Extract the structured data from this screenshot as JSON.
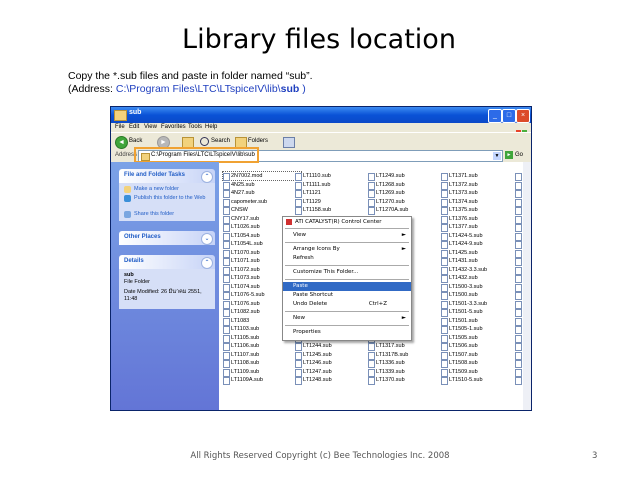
{
  "slide": {
    "title": "Library files location",
    "instruction_line1": "Copy the *.sub files and paste in folder named “sub”.",
    "instruction_address_prefix": "(Address: ",
    "instruction_address_path": "C:\\Program Files\\LTC\\LTspiceIV\\lib\\",
    "instruction_address_bold": "sub",
    "instruction_address_suffix": " )",
    "footer": "All Rights Reserved Copyright (c) Bee Technologies Inc. 2008",
    "page_number": "3"
  },
  "window": {
    "title": "sub",
    "menu": [
      "File",
      "Edit",
      "View",
      "Favorites",
      "Tools",
      "Help"
    ],
    "toolbar": {
      "back": "Back",
      "search": "Search",
      "folders": "Folders"
    },
    "address_label": "Address",
    "address_value": "C:\\Program Files\\LTC\\LTspiceIV\\lib\\sub",
    "go_label": "Go"
  },
  "taskpane": {
    "file_tasks_title": "File and Folder Tasks",
    "file_tasks": [
      "Make a new folder",
      "Publish this folder to the Web",
      "Share this folder"
    ],
    "other_places_title": "Other Places",
    "details_title": "Details",
    "details_name": "sub",
    "details_type": "File Folder",
    "details_modified": "Date Modified: 26 มีนาคม 2551,",
    "details_time": "11:48"
  },
  "files": {
    "col1": [
      "2N7002.mod",
      "4N25.sub",
      "4N27.sub",
      "capometer.sub",
      "CNSW",
      "CNY17.sub",
      "LT1026.sub",
      "LT1054.sub",
      "LT1054L.sub",
      "LT1070.sub",
      "LT1071.sub",
      "LT1072.sub",
      "LT1073.sub",
      "LT1074.sub",
      "LT1076-5.sub",
      "LT1076.sub",
      "LT1082.sub",
      "LT1083",
      "LT1103.sub",
      "LT1105.sub",
      "LT1106.sub",
      "LT1107.sub",
      "LT1108.sub",
      "LT1109.sub",
      "LT1109A.sub"
    ],
    "col2": [
      "LT1110.sub",
      "LT1111.sub",
      "LT1121",
      "LT1129",
      "LT1158.sub"
    ],
    "col2_bottom": [
      "LT1242.sub",
      "LT1243.sub",
      "LT1244.sub",
      "LT1245.sub",
      "LT1246.sub",
      "LT1247.sub",
      "LT1248.sub"
    ],
    "col3": [
      "LT1249.sub",
      "LT1268.sub",
      "LT1269.sub",
      "LT1270.sub",
      "LT1270A.sub"
    ],
    "col3_bottom": [
      "LT1310.sub",
      "LT1316.sub",
      "LT1317.sub",
      "LT1317B.sub",
      "LT1336.sub",
      "LT1339.sub",
      "LT1370.sub"
    ],
    "col4": [
      "LT1371.sub",
      "LT1372.sub",
      "LT1373.sub",
      "LT1374.sub",
      "LT1375.sub",
      "LT1376.sub",
      "LT1377.sub",
      "LT1424-5.sub",
      "LT1424-9.sub",
      "LT1425.sub",
      "LT1431.sub",
      "LT1432-3.3.sub",
      "LT1432.sub",
      "LT1500-3.sub",
      "LT1500.sub",
      "LT1501-3.3.sub",
      "LT1501-5.sub",
      "LT1501.sub",
      "LT1505-1.sub",
      "LT1505.sub",
      "LT1506.sub",
      "LT1507.sub",
      "LT1508.sub",
      "LT1509.sub",
      "LT1510-5.sub"
    ],
    "col5": [
      "LT",
      "LT",
      "LT",
      "LT",
      "LT",
      "LT",
      "LT",
      "LT",
      "LT",
      "LT",
      "LT",
      "LT",
      "LT",
      "LT",
      "LT",
      "LT",
      "LT",
      "LT",
      "LT",
      "LT",
      "LT",
      "LT",
      "LT",
      "LT",
      "LT"
    ]
  },
  "context_menu": {
    "header": "ATI CATALYST(R) Control Center",
    "view": "View",
    "arrange": "Arrange Icons By",
    "refresh": "Refresh",
    "customize": "Customize This Folder...",
    "paste": "Paste",
    "paste_shortcut": "Paste Shortcut",
    "undo": "Undo Delete",
    "undo_shortcut": "Ctrl+Z",
    "new": "New",
    "properties": "Properties"
  },
  "colors": {
    "title_bar": "#0a52d6",
    "task_pane": "#6f8ce0",
    "highlight": "#f0a232",
    "selection": "#316ac5"
  }
}
